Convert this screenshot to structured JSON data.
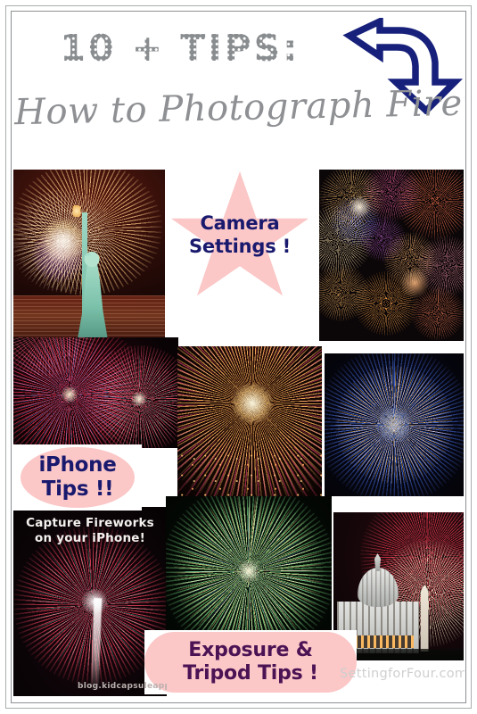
{
  "header": {
    "eyebrow": "10 + TIPS:",
    "title": "How to Photograph Fireworks!",
    "arrow_icon": "curved-down-arrow-icon",
    "arrow_color": "#17207a"
  },
  "theme": {
    "pink": "#fbc7c7",
    "navy": "#19196e",
    "plum": "#4b1354",
    "gray_text": "#8e9093",
    "frame": "#a9acae",
    "background": "#ffffff"
  },
  "collage": {
    "photos": [
      {
        "id": "statue-of-liberty-fireworks",
        "alt": "Statue of Liberty silhouetted against golden fireworks over the harbor",
        "palette": [
          "#f6c074",
          "#e8823c",
          "#7fd0b6",
          "#2a0d0a"
        ]
      },
      {
        "id": "multicolor-fireworks-cluster",
        "alt": "Dense cluster of many multicolored firework bursts",
        "palette": [
          "#ff8a4c",
          "#e8559a",
          "#6f63d8",
          "#f7d98a"
        ]
      },
      {
        "id": "red-fireworks-pair",
        "alt": "Two red and teal firework bursts side by side",
        "palette": [
          "#e8304f",
          "#c91f3c",
          "#57c8b0",
          "#6a7fd6"
        ]
      },
      {
        "id": "orange-pink-burst",
        "alt": "Large orange and pink radial firework burst",
        "palette": [
          "#ffb55c",
          "#f2683f",
          "#d93b78",
          "#1a0a08"
        ]
      },
      {
        "id": "blue-gold-burst",
        "alt": "Blue and gold spherical firework burst",
        "palette": [
          "#3a63d8",
          "#e3b35c",
          "#7da4f0",
          "#090912"
        ]
      },
      {
        "id": "iphone-red-fireworks",
        "alt": "Red and white fireworks photographed on an iPhone",
        "palette": [
          "#e03b52",
          "#f4f1ea",
          "#5fbfa0",
          "#140a0c"
        ]
      },
      {
        "id": "green-gold-burst",
        "alt": "Green and gold chrysanthemum firework burst",
        "palette": [
          "#6fd07a",
          "#e8d07a",
          "#c9c2a0",
          "#07110a"
        ]
      },
      {
        "id": "capitol-dome-fireworks",
        "alt": "US Capitol dome and Washington Monument with red fireworks",
        "palette": [
          "#e8364a",
          "#f6e7c8",
          "#cfd2d4",
          "#120a0c"
        ]
      }
    ]
  },
  "badges": {
    "camera_settings": {
      "line1": "Camera",
      "line2": "Settings !",
      "shape": "star"
    },
    "iphone_tips": {
      "line1": "iPhone",
      "line2": "Tips !!",
      "shape": "oval"
    },
    "exposure_tripod": {
      "line1": "Exposure &",
      "line2": "Tripod Tips !",
      "shape": "pill"
    }
  },
  "captions": {
    "iphone_photo": {
      "line1": "Capture Fireworks",
      "line2": "on your iPhone!"
    }
  },
  "watermarks": {
    "left": "blog.kidcapsuleapp.com",
    "right": "SettingforFour.com"
  }
}
